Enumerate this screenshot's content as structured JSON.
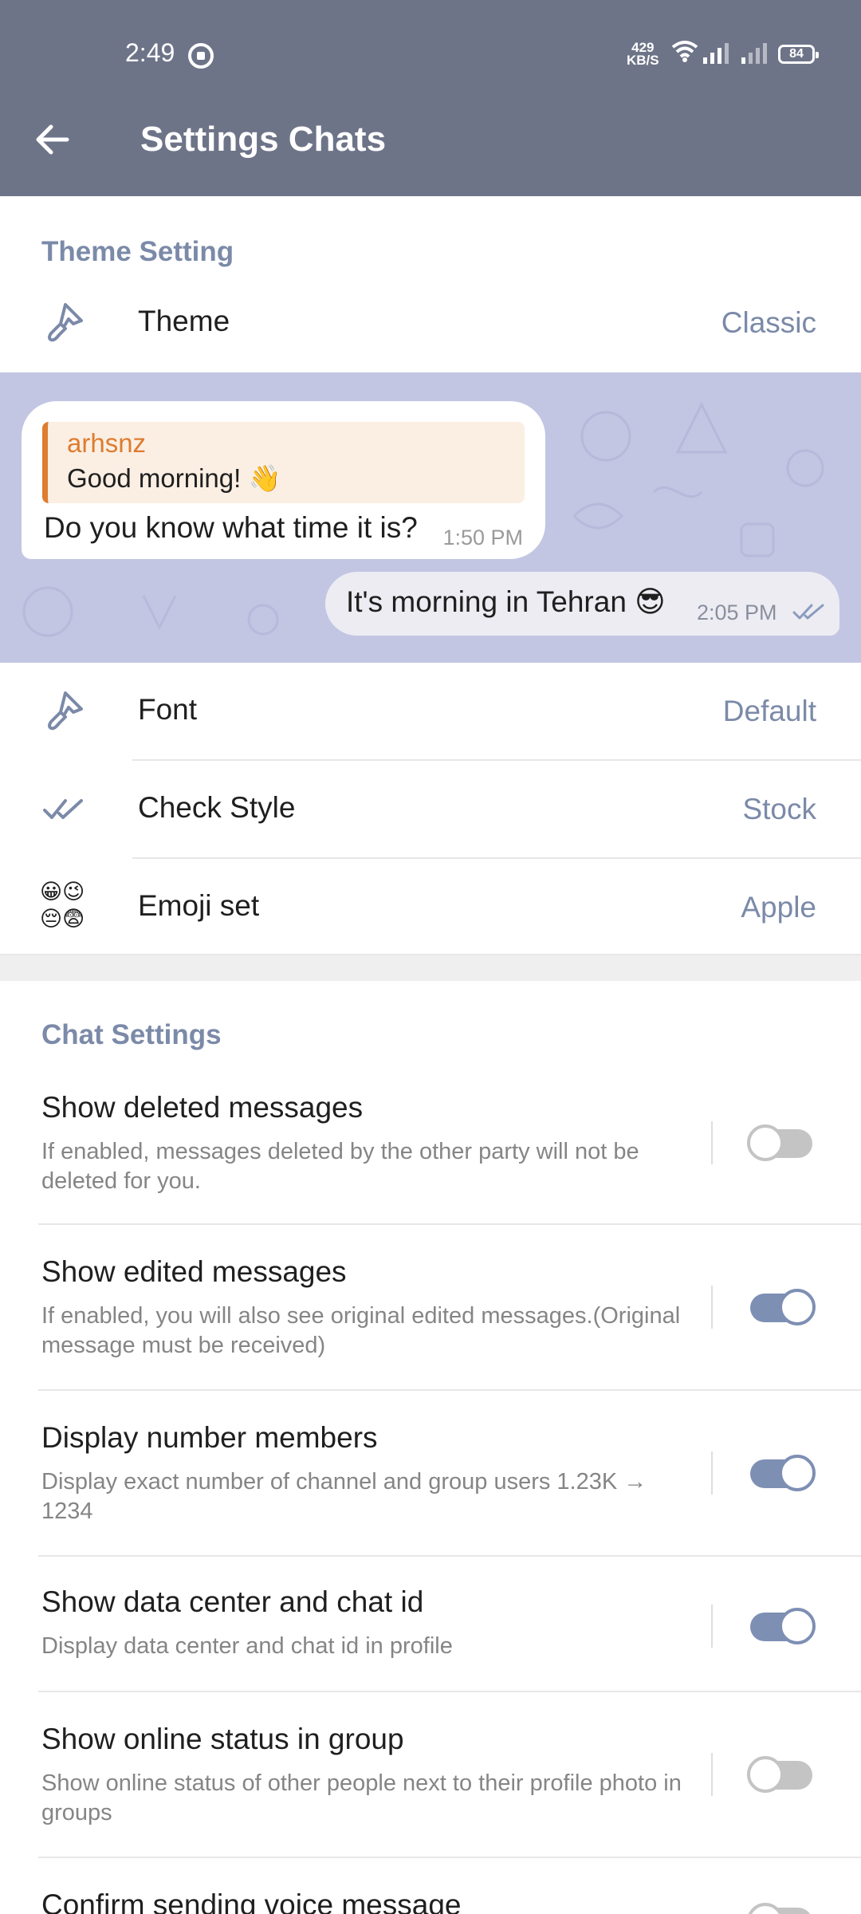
{
  "status_bar": {
    "time": "2:49",
    "net_speed_value": "429",
    "net_speed_unit": "KB/S",
    "battery": "84"
  },
  "app_bar": {
    "title": "Settings Chats",
    "back_icon": "arrow-left-icon"
  },
  "theme_section": {
    "header": "Theme Setting",
    "theme": {
      "label": "Theme",
      "value": "Classic",
      "icon": "brush-icon"
    }
  },
  "preview": {
    "incoming": {
      "reply_name": "arhsnz",
      "reply_text": "Good morning! 👋",
      "text": "Do you know what time it is?",
      "time": "1:50 PM"
    },
    "outgoing": {
      "text": "It's morning in Tehran 😎",
      "time": "2:05 PM",
      "check_icon": "double-check-icon"
    }
  },
  "style_rows": [
    {
      "label": "Font",
      "value": "Default",
      "icon": "brush-icon"
    },
    {
      "label": "Check Style",
      "value": "Stock",
      "icon": "double-check-icon"
    },
    {
      "label": "Emoji set",
      "value": "Apple",
      "icon": "emoji-set-icon",
      "emoji": [
        "😀",
        "😉",
        "😔",
        "😨"
      ]
    }
  ],
  "chat_settings": {
    "header": "Chat Settings",
    "items": [
      {
        "title": "Show deleted messages",
        "desc": "If enabled, messages deleted by the other party will not be deleted for you.",
        "on": false
      },
      {
        "title": "Show edited messages",
        "desc": "If enabled, you will also see original edited messages.(Original message must be received)",
        "on": true
      },
      {
        "title": "Display number members",
        "desc": "Display exact number of channel and group users 1.23K → 1234",
        "on": true
      },
      {
        "title": "Show data center and chat id",
        "desc": "Display data center and chat id in profile",
        "on": true
      },
      {
        "title": "Show online status in group",
        "desc": "Show online status of other people next to their profile photo in groups",
        "on": false
      },
      {
        "title": "Confirm sending voice message",
        "desc": "",
        "on": false
      }
    ]
  },
  "colors": {
    "app_bar": "#6e7488",
    "accent": "#7b8aa8",
    "reply_accent": "#de7c2f",
    "switch_on": "#7e8fb4",
    "switch_off": "#c4c4c4"
  }
}
